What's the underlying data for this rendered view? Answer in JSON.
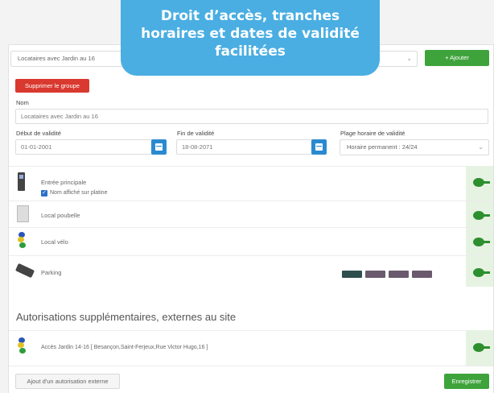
{
  "banner": {
    "line1": "Droit d’accès, tranches",
    "line2": "horaires et dates de validité",
    "line3": "facilitées"
  },
  "group": {
    "selected": "Locataires avec Jardin au 16",
    "add_label": "+ Ajouter",
    "delete_label": "Supprimer le groupe",
    "name_label": "Nom",
    "name_value": "Locataires avec Jardin au 16"
  },
  "validity": {
    "start_label": "Début de validité",
    "start_value": "01-01-2001",
    "end_label": "Fin de validité",
    "end_value": "18-08-2071",
    "schedule_label": "Plage horaire de validité",
    "schedule_value": "Horaire permanent : 24/24"
  },
  "doors": [
    {
      "name": "Entrée principale",
      "icon": "intercom-panel-icon",
      "checkbox_label": "Nom affiché sur platine"
    },
    {
      "name": "Local poubelle",
      "icon": "door-icon"
    },
    {
      "name": "Local vélo",
      "icon": "traffic-light-icon"
    },
    {
      "name": "Parking",
      "icon": "remote-control-icon"
    }
  ],
  "external": {
    "title": "Autorisations supplémentaires, externes au site",
    "items": [
      {
        "name": "Accès Jardin 14-16 [ Besançon,Saint-Ferjeux,Rue Victor Hugo,16 ]",
        "icon": "traffic-light-icon"
      }
    ],
    "add_label": "Ajout d'un autorisation externe",
    "save_label": "Enregistrer"
  },
  "colors": {
    "banner": "#4aaee2",
    "primary_green": "#3fa33c",
    "danger_red": "#d9392f",
    "key_green": "#2e8f2f",
    "calendar_blue": "#2a8ad1"
  }
}
